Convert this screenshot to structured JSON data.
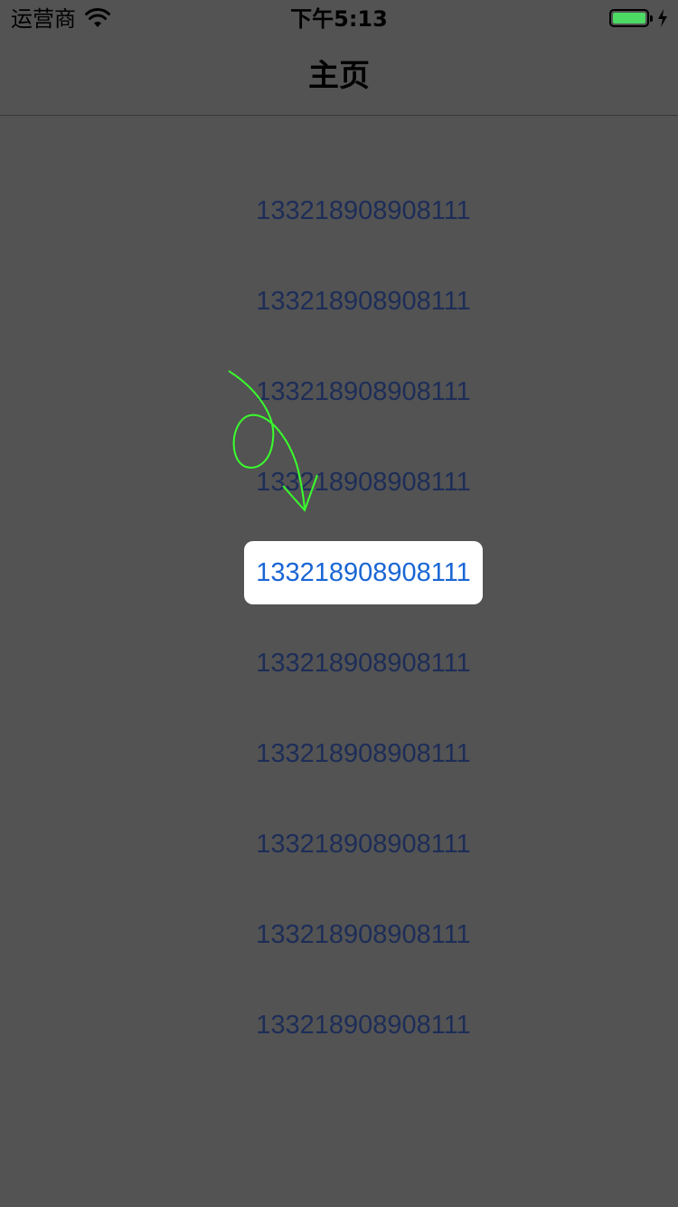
{
  "status_bar": {
    "carrier": "运营商",
    "time": "下午5:13",
    "battery_level": 1.0,
    "icons": [
      "wifi-icon",
      "battery-icon",
      "charging-icon"
    ]
  },
  "nav": {
    "title": "主页"
  },
  "list": {
    "items": [
      {
        "label": "133218908908111"
      },
      {
        "label": "133218908908111"
      },
      {
        "label": "133218908908111"
      },
      {
        "label": "133218908908111"
      },
      {
        "label": "133218908908111"
      },
      {
        "label": "133218908908111"
      },
      {
        "label": "133218908908111"
      },
      {
        "label": "133218908908111"
      },
      {
        "label": "133218908908111"
      },
      {
        "label": "133218908908111"
      }
    ],
    "selected_index": 4
  },
  "colors": {
    "background": "#535353",
    "item_text": "#1d2d58",
    "selected_bg": "#ffffff",
    "selected_text": "#1a66d4",
    "battery_fill": "#4cd964",
    "gesture_stroke": "#39ff2c"
  },
  "overlay": {
    "icon": "scroll-gesture-arrow-icon"
  }
}
